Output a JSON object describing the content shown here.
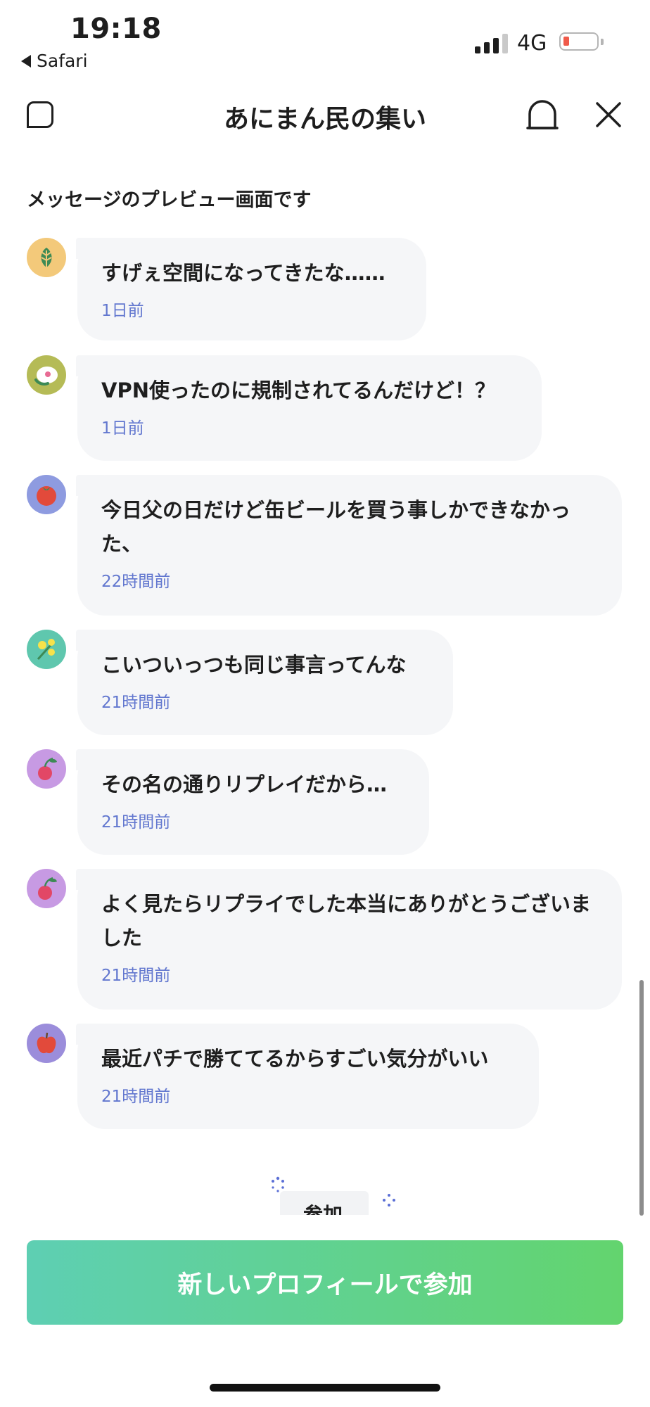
{
  "status_bar": {
    "time": "19:18",
    "back_app": "Safari",
    "network": "4G",
    "battery_level": 0.15
  },
  "header": {
    "title": "あにまん民の集い",
    "icons": [
      "square-icon",
      "bell-icon",
      "close-icon"
    ]
  },
  "preview_label": "メッセージのプレビュー画面です",
  "messages": [
    {
      "text": "すげぇ空間になってきたな……",
      "time": "1日前",
      "avatar": "leaf",
      "avatar_color": "#f3c97a"
    },
    {
      "text": "VPN使ったのに規制されてるんだけど！？",
      "time": "1日前",
      "avatar": "rice-ball",
      "avatar_color": "#b5bb56"
    },
    {
      "text": "今日父の日だけど缶ビールを買う事しかできなかった、",
      "time": "22時間前",
      "avatar": "tomato",
      "avatar_color": "#8e9be0"
    },
    {
      "text": "こいついっつも同じ事言ってんな",
      "time": "21時間前",
      "avatar": "mimosa",
      "avatar_color": "#5fc7ae"
    },
    {
      "text": "その名の通りリプレイだから…",
      "time": "21時間前",
      "avatar": "cherry",
      "avatar_color": "#c79ae3"
    },
    {
      "text": "よく見たらリプライでした本当にありがとうございました",
      "time": "21時間前",
      "avatar": "cherry",
      "avatar_color": "#c79ae3"
    },
    {
      "text": "最近パチで勝ててるからすごい気分がいい",
      "time": "21時間前",
      "avatar": "apple",
      "avatar_color": "#9b8ddb"
    }
  ],
  "join_chip": "参加",
  "join_button": "新しいプロフィールで参加",
  "colors": {
    "bubble_bg": "#f5f6f8",
    "time_text": "#6277cf",
    "button_gradient_start": "#5ecfb3",
    "button_gradient_end": "#63d46e"
  }
}
